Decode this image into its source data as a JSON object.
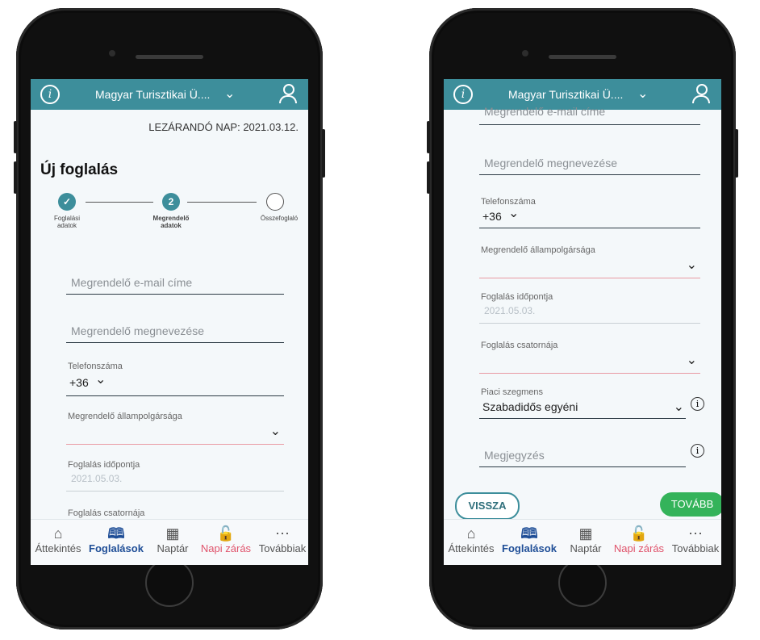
{
  "colors": {
    "brand": "#3d8e9b",
    "accent_green": "#34b35a",
    "active_nav": "#1f4e97",
    "alert": "#e0536b"
  },
  "appbar": {
    "title": "Magyar Turisztikai Ü....",
    "info_icon": "i"
  },
  "left": {
    "closing_day": "LEZÁRANDÓ NAP: 2021.03.12.",
    "page_title": "Új foglalás",
    "steps": [
      {
        "label_line1": "Foglalási",
        "label_line2": "adatok",
        "state": "done"
      },
      {
        "label_line1": "Megrendelő",
        "label_line2": "adatok",
        "state": "current",
        "number": "2"
      },
      {
        "label_line1": "Összefoglaló",
        "label_line2": "",
        "state": "todo"
      }
    ],
    "email_placeholder": "Megrendelő e-mail címe",
    "name_placeholder": "Megrendelő megnevezése",
    "phone_label": "Telefonszáma",
    "phone_prefix": "+36",
    "citizenship_label": "Megrendelő állampolgársága",
    "booking_time_label": "Foglalás időpontja",
    "booking_time_value": "2021.05.03.",
    "channel_label": "Foglalás csatornája"
  },
  "right": {
    "email_placeholder": "Megrendelő e-mail címe",
    "name_placeholder": "Megrendelő megnevezése",
    "phone_label": "Telefonszáma",
    "phone_prefix": "+36",
    "citizenship_label": "Megrendelő állampolgársága",
    "booking_time_label": "Foglalás időpontja",
    "booking_time_value": "2021.05.03.",
    "channel_label": "Foglalás csatornája",
    "segment_label": "Piaci szegmens",
    "segment_value": "Szabadidős egyéni",
    "note_placeholder": "Megjegyzés",
    "back_button": "VISSZA",
    "next_button": "TOVÁBB"
  },
  "nav": [
    {
      "label": "Áttekintés",
      "icon": "home-icon"
    },
    {
      "label": "Foglalások",
      "icon": "book-icon"
    },
    {
      "label": "Naptár",
      "icon": "calendar-icon"
    },
    {
      "label": "Napi zárás",
      "icon": "unlock-icon"
    },
    {
      "label": "Továbbiak",
      "icon": "more-icon"
    }
  ]
}
